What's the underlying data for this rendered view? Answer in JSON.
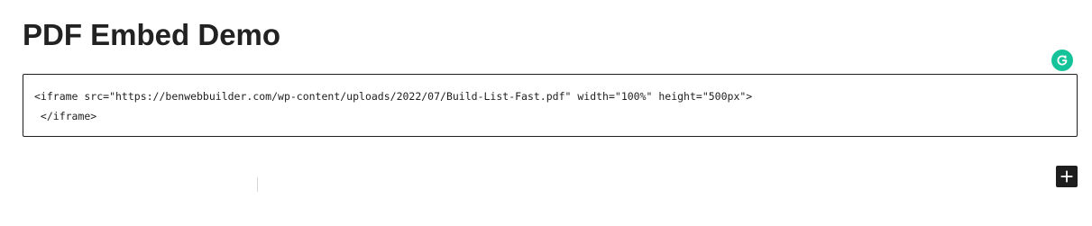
{
  "page": {
    "title": "PDF Embed Demo"
  },
  "code_block": {
    "lines": [
      "<iframe src=\"https://benwebbuilder.com/wp-content/uploads/2022/07/Build-List-Fast.pdf\" width=\"100%\" height=\"500px\">",
      " </iframe>"
    ]
  },
  "icons": {
    "grammarly": "grammarly-icon",
    "add_block": "plus-icon"
  },
  "colors": {
    "grammarly_green": "#15c39a",
    "add_button_bg": "#1e1e1e",
    "text": "#222222",
    "border": "#1e1e1e"
  }
}
